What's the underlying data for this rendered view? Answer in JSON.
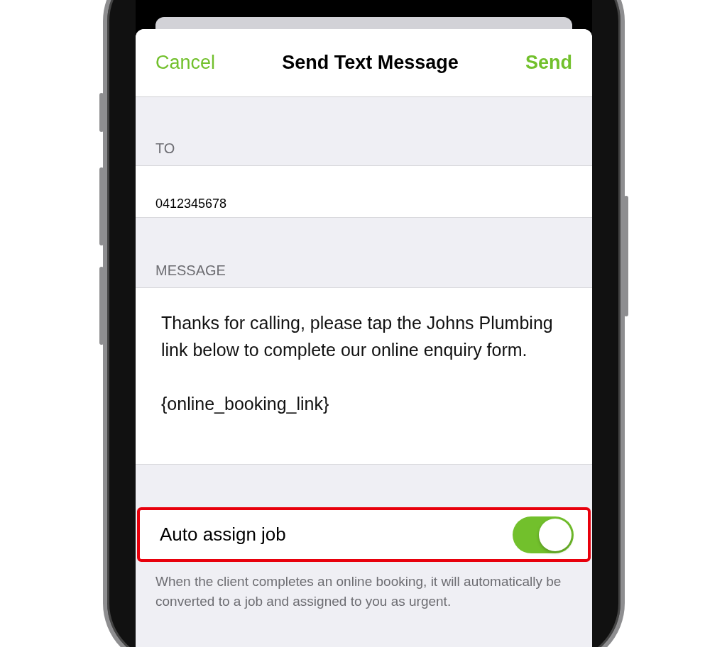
{
  "nav": {
    "cancel": "Cancel",
    "title": "Send Text Message",
    "send": "Send"
  },
  "sections": [
    {
      "header": "TO",
      "kind": "field",
      "value": "0412345678"
    },
    {
      "header": "MESSAGE",
      "kind": "message",
      "paragraphs": [
        "Thanks for calling, please tap the Johns Plumbing link below to complete our online enquiry form.",
        "{online_booking_link}"
      ]
    }
  ],
  "toggle": {
    "label": "Auto assign job",
    "on": true,
    "highlighted": true
  },
  "footer": "When the client completes an online booking, it will automatically be converted to a job and assigned to you as urgent."
}
